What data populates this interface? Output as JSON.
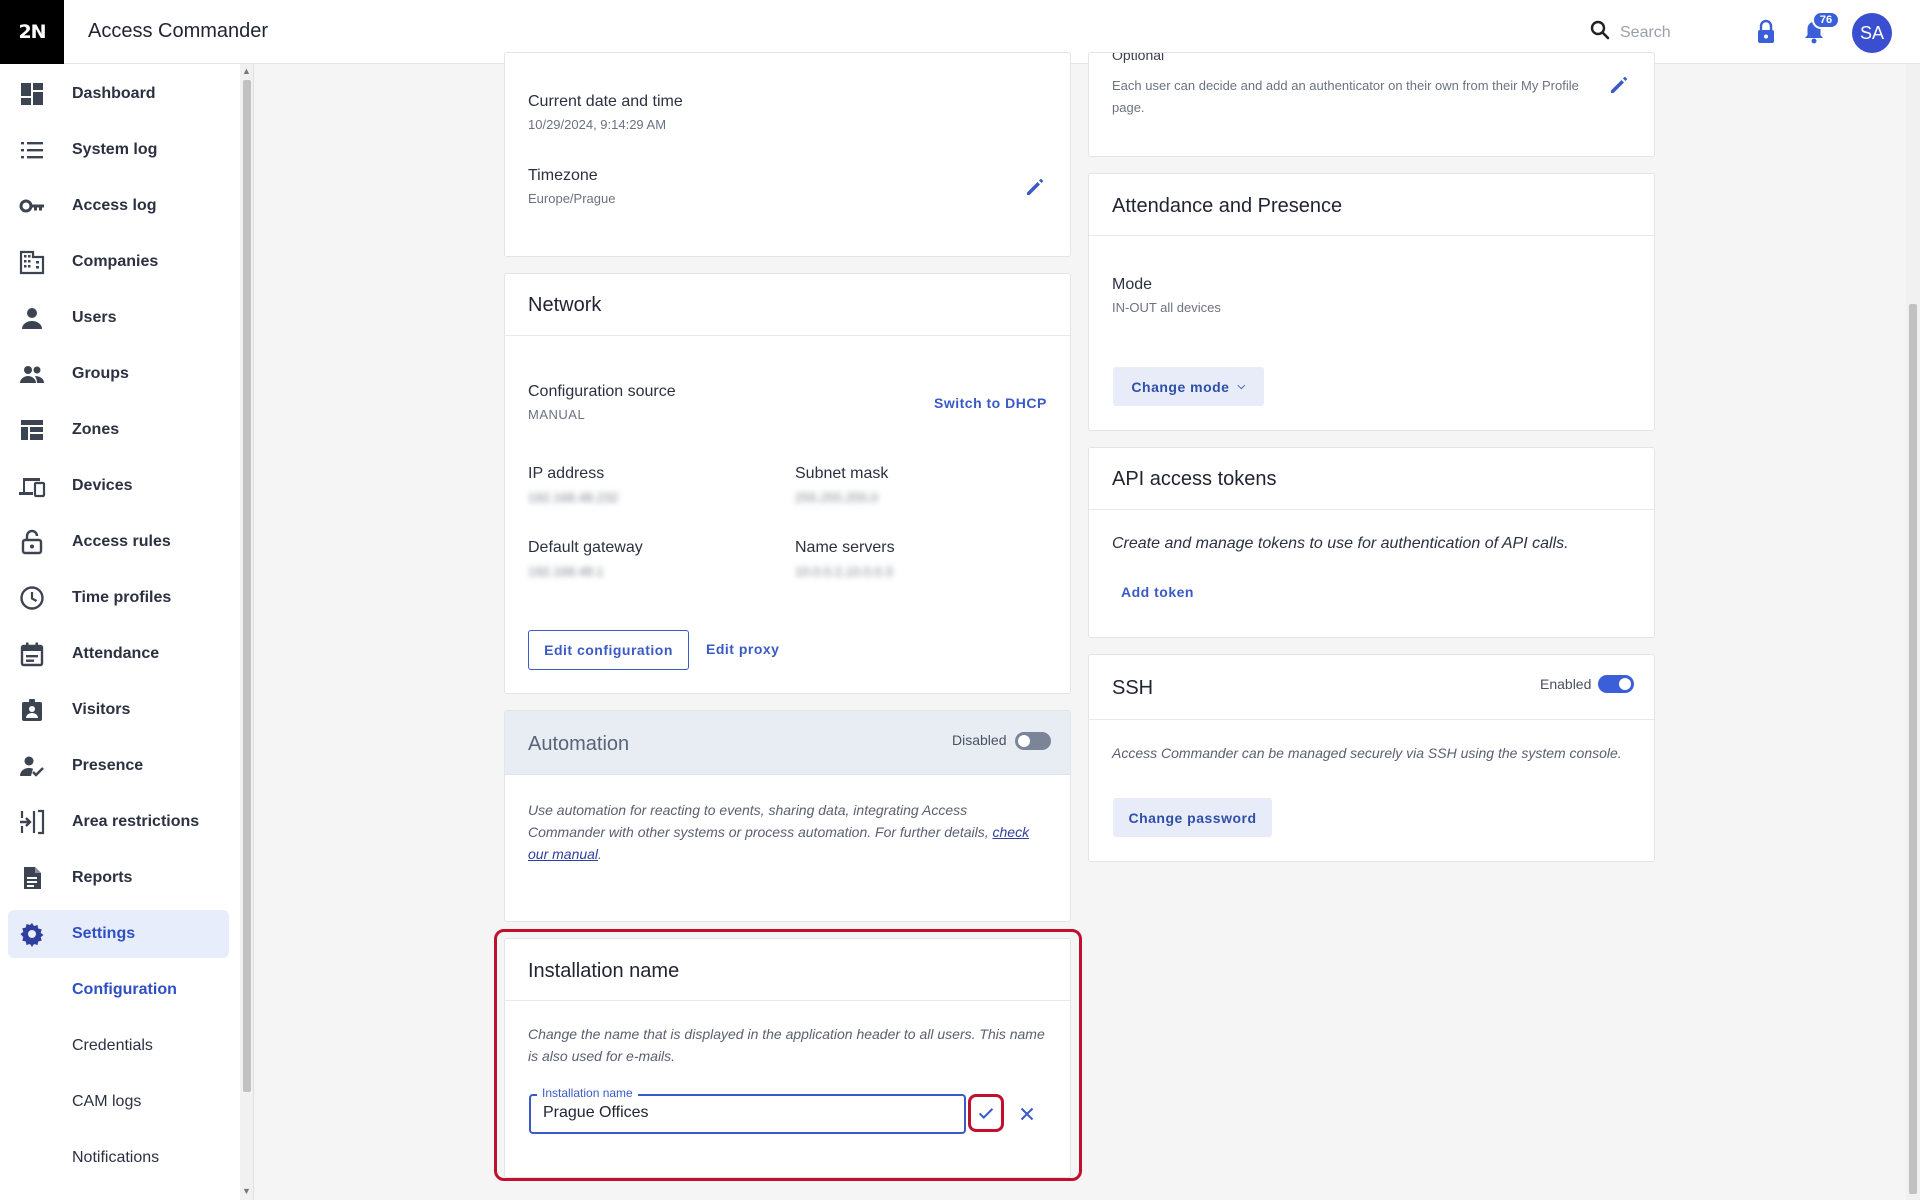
{
  "header": {
    "logo": "2N",
    "app_title": "Access Commander",
    "search_placeholder": "Search",
    "notifications_count": "76",
    "avatar_initials": "SA"
  },
  "sidebar": {
    "items": [
      {
        "label": "Dashboard",
        "icon": "dashboard-icon"
      },
      {
        "label": "System log",
        "icon": "list-icon"
      },
      {
        "label": "Access log",
        "icon": "key-icon"
      },
      {
        "label": "Companies",
        "icon": "building-icon"
      },
      {
        "label": "Users",
        "icon": "person-icon"
      },
      {
        "label": "Groups",
        "icon": "group-icon"
      },
      {
        "label": "Zones",
        "icon": "zones-icon"
      },
      {
        "label": "Devices",
        "icon": "devices-icon"
      },
      {
        "label": "Access rules",
        "icon": "lock-open-icon"
      },
      {
        "label": "Time profiles",
        "icon": "clock-icon"
      },
      {
        "label": "Attendance",
        "icon": "calendar-icon"
      },
      {
        "label": "Visitors",
        "icon": "badge-icon"
      },
      {
        "label": "Presence",
        "icon": "person-check-icon"
      },
      {
        "label": "Area restrictions",
        "icon": "area-icon"
      },
      {
        "label": "Reports",
        "icon": "document-icon"
      },
      {
        "label": "Settings",
        "icon": "gear-icon"
      }
    ],
    "sub_items": [
      "Configuration",
      "Credentials",
      "CAM logs",
      "Notifications"
    ]
  },
  "datetime_card": {
    "current_label": "Current date and time",
    "current_value": "10/29/2024, 9:14:29 AM",
    "timezone_label": "Timezone",
    "timezone_value": "Europe/Prague"
  },
  "network": {
    "title": "Network",
    "config_source_label": "Configuration source",
    "config_source_value": "MANUAL",
    "switch_dhcp": "Switch to DHCP",
    "ip_label": "IP address",
    "ip_value": "192.168.48.232",
    "subnet_label": "Subnet mask",
    "subnet_value": "255.255.255.0",
    "gateway_label": "Default gateway",
    "gateway_value": "192.168.48.1",
    "ns_label": "Name servers",
    "ns_value": "10.0.0.2,10.0.0.3",
    "edit_config": "Edit configuration",
    "edit_proxy": "Edit proxy"
  },
  "automation": {
    "title": "Automation",
    "toggle_label": "Disabled",
    "enabled": false,
    "desc": "Use automation for reacting to events, sharing data, integrating Access Commander with other systems or process automation. For further details, ",
    "link": "check our manual",
    "desc_end": "."
  },
  "installation": {
    "title": "Installation name",
    "desc": "Change the name that is displayed in the application header to all users. This name is also used for e-mails.",
    "input_label": "Installation name",
    "input_value": "Prague Offices"
  },
  "optional_card": {
    "label": "Optional",
    "desc": "Each user can decide and add an authenticator on their own from their My Profile page."
  },
  "attendance_card": {
    "title": "Attendance and Presence",
    "mode_label": "Mode",
    "mode_value": "IN-OUT all devices",
    "change_mode": "Change mode"
  },
  "api_card": {
    "title": "API access tokens",
    "desc": "Create and manage tokens to use for authentication of API calls.",
    "add_token": "Add token"
  },
  "ssh_card": {
    "title": "SSH",
    "toggle_label": "Enabled",
    "enabled": true,
    "desc": "Access Commander can be managed securely via SSH using the system console.",
    "change_password": "Change password"
  },
  "colors": {
    "accent": "#3a5bc7",
    "highlight": "#c0102e"
  }
}
